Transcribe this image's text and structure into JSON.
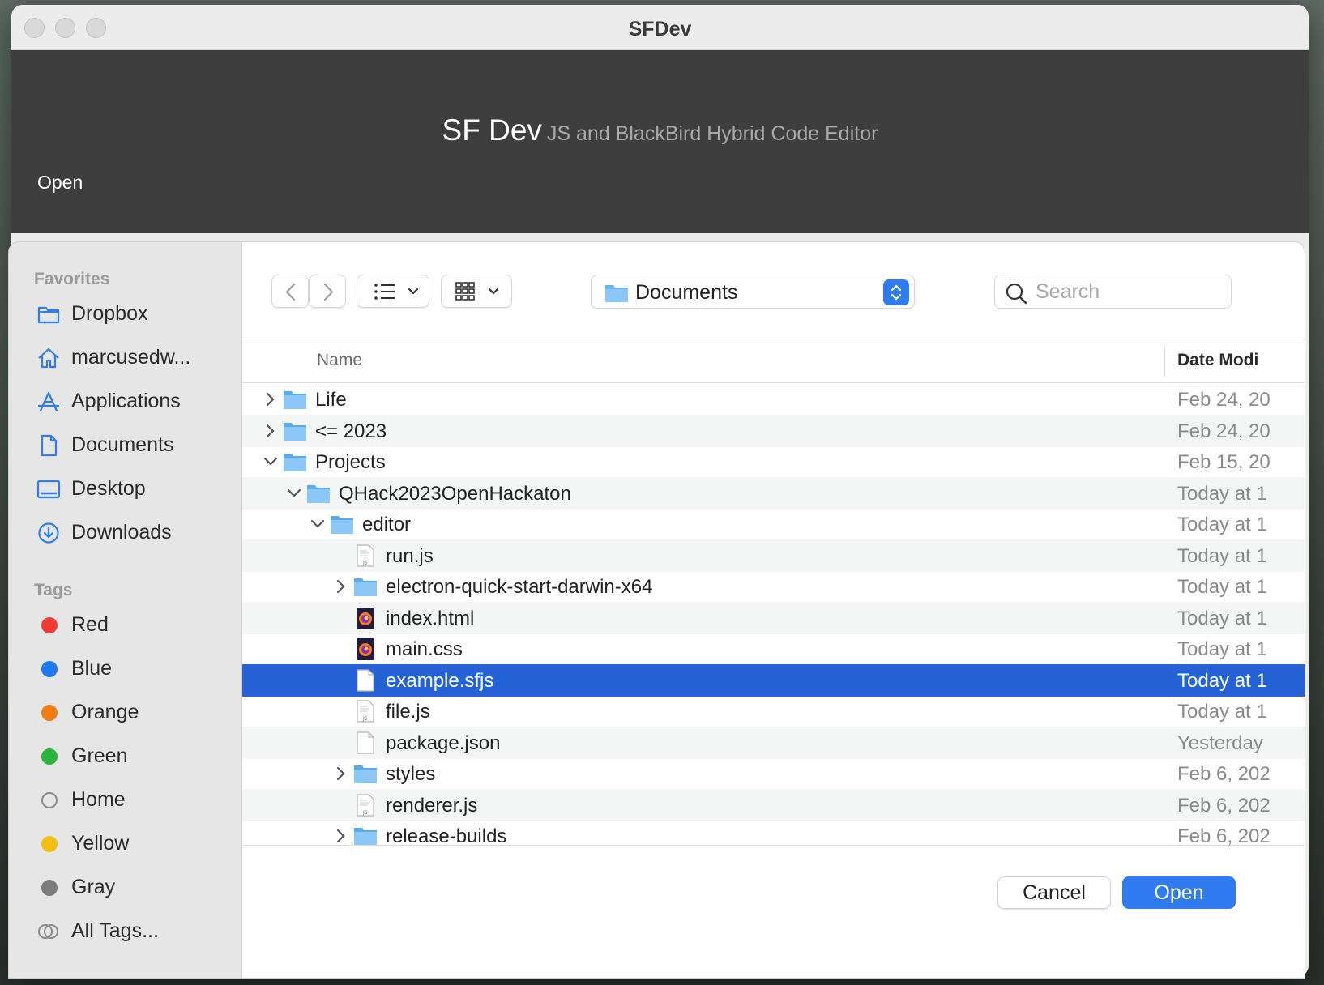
{
  "window": {
    "title": "SFDev"
  },
  "app_header": {
    "name": "SF Dev",
    "subtitle": "JS and BlackBird Hybrid Code Editor",
    "action_label": "Open"
  },
  "sidebar": {
    "favorites_label": "Favorites",
    "favorites": [
      {
        "label": "Dropbox",
        "icon": "folder-icon"
      },
      {
        "label": "marcusedw...",
        "icon": "home-icon"
      },
      {
        "label": "Applications",
        "icon": "applications-icon"
      },
      {
        "label": "Documents",
        "icon": "document-icon"
      },
      {
        "label": "Desktop",
        "icon": "desktop-icon"
      },
      {
        "label": "Downloads",
        "icon": "download-icon"
      }
    ],
    "tags_label": "Tags",
    "tags": [
      {
        "label": "Red",
        "color": "#f03b32"
      },
      {
        "label": "Blue",
        "color": "#1f78f0"
      },
      {
        "label": "Orange",
        "color": "#ef7e15"
      },
      {
        "label": "Green",
        "color": "#2ab43c"
      },
      {
        "label": "Home",
        "color": ""
      },
      {
        "label": "Yellow",
        "color": "#f2bf15"
      },
      {
        "label": "Gray",
        "color": "#7c7c7c"
      },
      {
        "label": "All Tags...",
        "color": ""
      }
    ]
  },
  "toolbar": {
    "location": "Documents",
    "search_placeholder": "Search"
  },
  "columns": {
    "name": "Name",
    "date": "Date Modi"
  },
  "files": [
    {
      "name": "Life",
      "date": "Feb 24, 20",
      "kind": "folder",
      "expand": "collapsed"
    },
    {
      "name": "<= 2023",
      "date": "Feb 24, 20",
      "kind": "folder",
      "expand": "collapsed"
    },
    {
      "name": "Projects",
      "date": "Feb 15, 20",
      "kind": "folder",
      "expand": "expanded"
    },
    {
      "name": "QHack2023OpenHackaton",
      "date": "Today at 1",
      "kind": "folder",
      "expand": "expanded"
    },
    {
      "name": "editor",
      "date": "Today at 1",
      "kind": "folder",
      "expand": "expanded"
    },
    {
      "name": "run.js",
      "date": "Today at 1",
      "kind": "js",
      "expand": ""
    },
    {
      "name": "electron-quick-start-darwin-x64",
      "date": "Today at 1",
      "kind": "folder",
      "expand": "collapsed"
    },
    {
      "name": "index.html",
      "date": "Today at 1",
      "kind": "firefox",
      "expand": ""
    },
    {
      "name": "main.css",
      "date": "Today at 1",
      "kind": "firefox",
      "expand": ""
    },
    {
      "name": "example.sfjs",
      "date": "Today at 1",
      "kind": "doc",
      "expand": "",
      "selected": true
    },
    {
      "name": "file.js",
      "date": "Today at 1",
      "kind": "js",
      "expand": ""
    },
    {
      "name": "package.json",
      "date": "Yesterday",
      "kind": "doc",
      "expand": ""
    },
    {
      "name": "styles",
      "date": "Feb 6, 202",
      "kind": "folder",
      "expand": "collapsed"
    },
    {
      "name": "renderer.js",
      "date": "Feb 6, 202",
      "kind": "js",
      "expand": ""
    },
    {
      "name": "release-builds",
      "date": "Feb 6, 202",
      "kind": "folder",
      "expand": "collapsed"
    }
  ],
  "buttons": {
    "cancel": "Cancel",
    "open": "Open"
  }
}
